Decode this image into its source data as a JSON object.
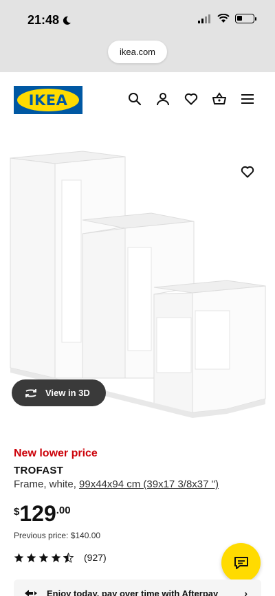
{
  "status_bar": {
    "time": "21:48",
    "icons": [
      "moon-icon",
      "signal-icon",
      "wifi-icon",
      "battery-icon"
    ]
  },
  "browser": {
    "url": "ikea.com"
  },
  "header": {
    "logo_text": "IKEA",
    "icons": [
      "search-icon",
      "account-icon",
      "heart-icon",
      "basket-icon",
      "menu-icon"
    ]
  },
  "product": {
    "badge": "New lower price",
    "name": "TROFAST",
    "description": "Frame, white,",
    "dimensions": "99x44x94 cm (39x17 3/8x37 \")",
    "price": {
      "currency": "$",
      "integer": "129",
      "decimal": ".00"
    },
    "previous_price": "Previous price: $140.00",
    "rating": {
      "stars": 4.5,
      "count": "(927)"
    },
    "view_3d_label": "View in 3D"
  },
  "afterpay": {
    "text": "Enjoy today, pay over time with Afterpay"
  },
  "colors": {
    "ikea_blue": "#0058a3",
    "ikea_yellow": "#ffdb00",
    "price_red": "#cc0008"
  }
}
